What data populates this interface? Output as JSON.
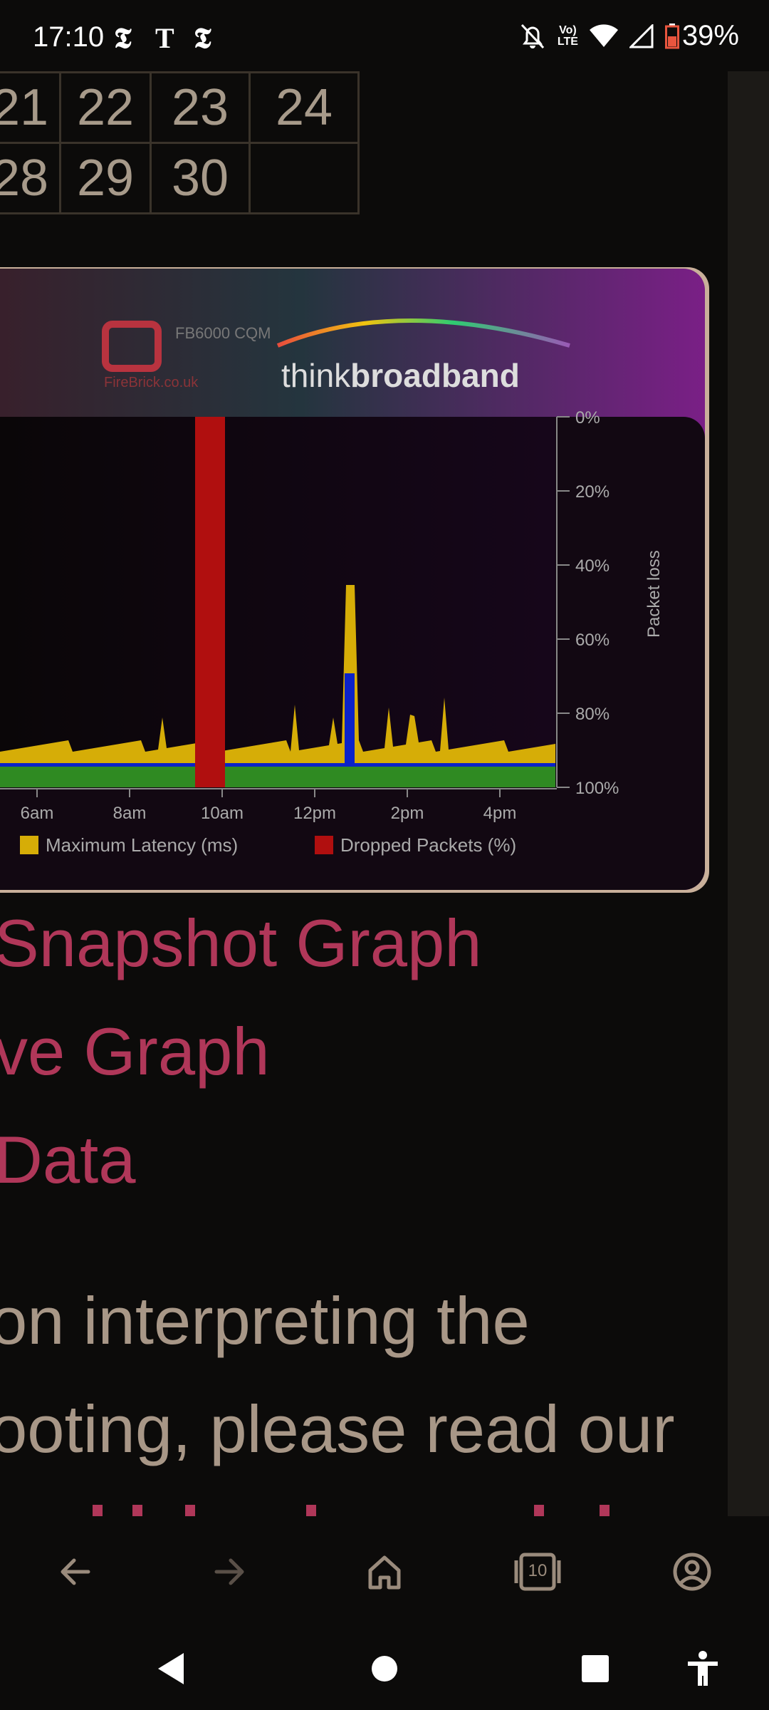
{
  "status_bar": {
    "time": "17:10",
    "news_icons": [
      "𝕿",
      "T",
      "𝕿"
    ],
    "volte": [
      "Vo)",
      "LTE"
    ],
    "battery": "39%"
  },
  "calendar": {
    "rows": [
      [
        "21",
        "22",
        "23",
        "24"
      ],
      [
        "28",
        "29",
        "30",
        ""
      ]
    ]
  },
  "graph": {
    "brand_fb": "FB6000 CQM",
    "brand_fb_site": "FireBrick.co.uk",
    "brand_tbb_a": "think",
    "brand_tbb_b": "broadband",
    "y_ticks": [
      "0%",
      "20%",
      "40%",
      "60%",
      "80%",
      "100%"
    ],
    "y_axis_label": "Packet loss",
    "x_ticks": [
      "6am",
      "8am",
      "10am",
      "12pm",
      "2pm",
      "4pm"
    ],
    "legend": [
      "Maximum Latency (ms)",
      "Dropped Packets (%)"
    ],
    "colors": {
      "latency": "#d6ad07",
      "drop": "#b00f0f",
      "blue": "#0b22c9",
      "green": "#2f8a22"
    }
  },
  "links": [
    "Snapshot Graph",
    "ve Graph",
    " Data"
  ],
  "paragraph": [
    "on interpreting the",
    "ooting, please read our"
  ],
  "toolbar": {
    "back": "back-arrow",
    "forward": "forward-arrow",
    "home": "home",
    "tabs_count": "10",
    "account": "account"
  },
  "system_nav": [
    "back-triangle",
    "home-circle",
    "recents-square",
    "accessibility"
  ]
}
